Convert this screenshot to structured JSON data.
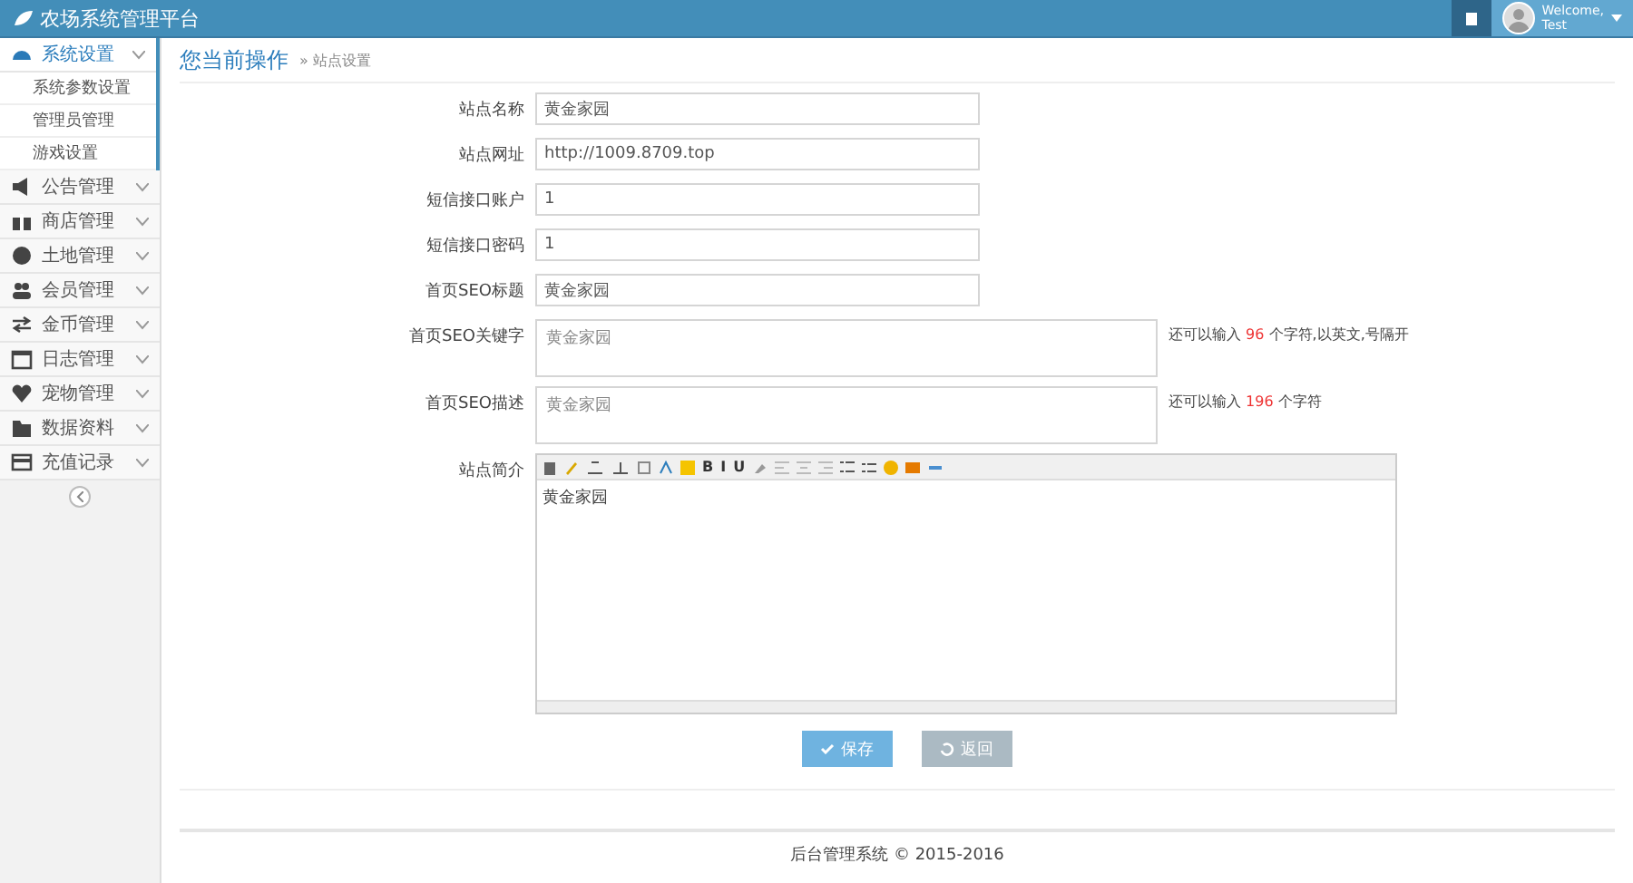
{
  "header": {
    "title": "农场系统管理平台",
    "welcome": "Welcome,",
    "user": "Test"
  },
  "sidebar": {
    "items": [
      {
        "label": "系统设置",
        "expanded": true,
        "children": [
          {
            "label": "系统参数设置",
            "selected": false
          },
          {
            "label": "管理员管理",
            "selected": false
          },
          {
            "label": "游戏设置",
            "selected": false
          }
        ]
      },
      {
        "label": "公告管理",
        "expanded": false
      },
      {
        "label": "商店管理",
        "expanded": false
      },
      {
        "label": "土地管理",
        "expanded": false
      },
      {
        "label": "会员管理",
        "expanded": false
      },
      {
        "label": "金币管理",
        "expanded": false
      },
      {
        "label": "日志管理",
        "expanded": false
      },
      {
        "label": "宠物管理",
        "expanded": false
      },
      {
        "label": "数据资料",
        "expanded": false
      },
      {
        "label": "充值记录",
        "expanded": false
      }
    ]
  },
  "breadcrumb": {
    "title": "您当前操作",
    "current": "» 站点设置"
  },
  "form": {
    "fields": [
      {
        "kind": "input",
        "label": "站点名称",
        "value": "黄金家园"
      },
      {
        "kind": "input",
        "label": "站点网址",
        "value": "http://1009.8709.top"
      },
      {
        "kind": "input",
        "label": "短信接口账户",
        "value": "1"
      },
      {
        "kind": "input",
        "label": "短信接口密码",
        "value": "1"
      },
      {
        "kind": "input",
        "label": "首页SEO标题",
        "value": "黄金家园"
      },
      {
        "kind": "textarea",
        "label": "首页SEO关键字",
        "value": "黄金家园",
        "hint_before": "还可以输入",
        "count": "96",
        "hint_after": "个字符,以英文,号隔开"
      },
      {
        "kind": "textarea",
        "label": "首页SEO描述",
        "value": "黄金家园",
        "hint_before": "还可以输入",
        "count": "196",
        "hint_after": "个字符"
      },
      {
        "kind": "editor",
        "label": "站点简介",
        "value": "黄金家园",
        "toolbar_text": [
          "B",
          "I",
          "U"
        ]
      }
    ]
  },
  "buttons": [
    {
      "kind": "primary",
      "label": "保存"
    },
    {
      "kind": "secondary",
      "label": "返回"
    }
  ],
  "footer": "后台管理系统 © 2015-2016"
}
